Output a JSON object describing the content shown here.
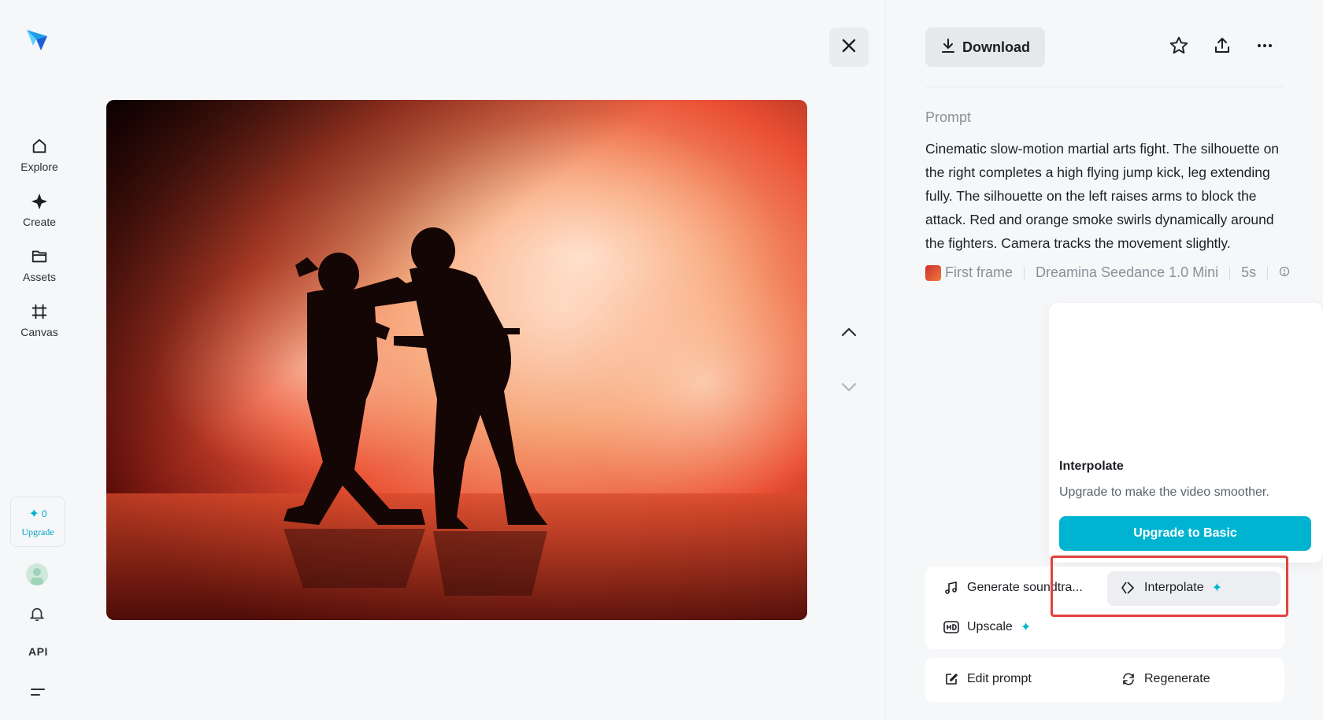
{
  "sidebar": {
    "items": [
      {
        "label": "Explore",
        "icon": "home-icon"
      },
      {
        "label": "Create",
        "icon": "sparkle-icon"
      },
      {
        "label": "Assets",
        "icon": "folder-icon"
      },
      {
        "label": "Canvas",
        "icon": "frame-icon"
      }
    ],
    "credits": "0",
    "upgrade_label": "Upgrade",
    "api_label": "API"
  },
  "header": {
    "download_label": "Download"
  },
  "prompt": {
    "label": "Prompt",
    "text": "Cinematic slow-motion martial arts fight. The silhouette on the right completes a high flying jump kick, leg extending fully. The silhouette on the left raises arms to block the attack. Red and orange smoke swirls dynamically around the fighters. Camera tracks the movement slightly.",
    "meta": {
      "first_frame": "First frame",
      "model": "Dreamina Seedance 1.0 Mini",
      "duration": "5s"
    }
  },
  "popover": {
    "title": "Interpolate",
    "description": "Upgrade to make the video smoother.",
    "button_label": "Upgrade to Basic"
  },
  "actions": {
    "generate_soundtrack": "Generate soundtra...",
    "interpolate": "Interpolate",
    "upscale": "Upscale",
    "edit_prompt": "Edit prompt",
    "regenerate": "Regenerate"
  },
  "colors": {
    "accent": "#00b4d1",
    "highlight": "#e2433c"
  }
}
